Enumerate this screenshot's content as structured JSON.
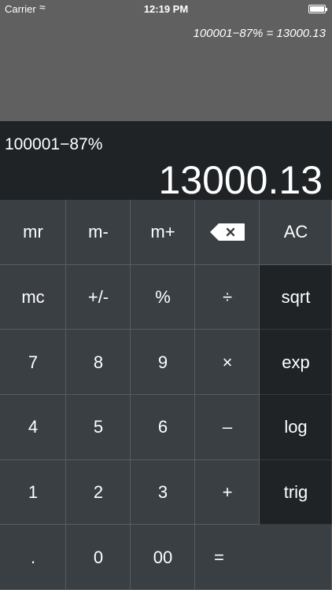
{
  "status_bar": {
    "carrier": "Carrier",
    "time": "12:19 PM"
  },
  "history": {
    "line": "100001−87% = 13000.13"
  },
  "display": {
    "expression": "100001−87%",
    "result": "13000.13"
  },
  "keys": [
    [
      {
        "label": "mr"
      },
      {
        "label": "m-"
      },
      {
        "label": "m+"
      },
      {
        "label": "",
        "icon": "backspace-icon"
      },
      {
        "label": "AC"
      }
    ],
    [
      {
        "label": "mc"
      },
      {
        "label": "+/-"
      },
      {
        "label": "%"
      },
      {
        "label": "÷"
      },
      {
        "label": "sqrt"
      }
    ],
    [
      {
        "label": "7"
      },
      {
        "label": "8"
      },
      {
        "label": "9"
      },
      {
        "label": "×"
      },
      {
        "label": "exp"
      }
    ],
    [
      {
        "label": "4"
      },
      {
        "label": "5"
      },
      {
        "label": "6"
      },
      {
        "label": "–"
      },
      {
        "label": "log"
      }
    ],
    [
      {
        "label": "1"
      },
      {
        "label": "2"
      },
      {
        "label": "3"
      },
      {
        "label": "+"
      },
      {
        "label": "trig"
      }
    ],
    [
      {
        "label": "."
      },
      {
        "label": "0"
      },
      {
        "label": "00"
      },
      {
        "label": "="
      }
    ]
  ],
  "colors": {
    "history_bg": "#606060",
    "display_bg": "#1f2326",
    "key_bg": "#3a3f44",
    "function_key_bg": "#1f2326"
  }
}
